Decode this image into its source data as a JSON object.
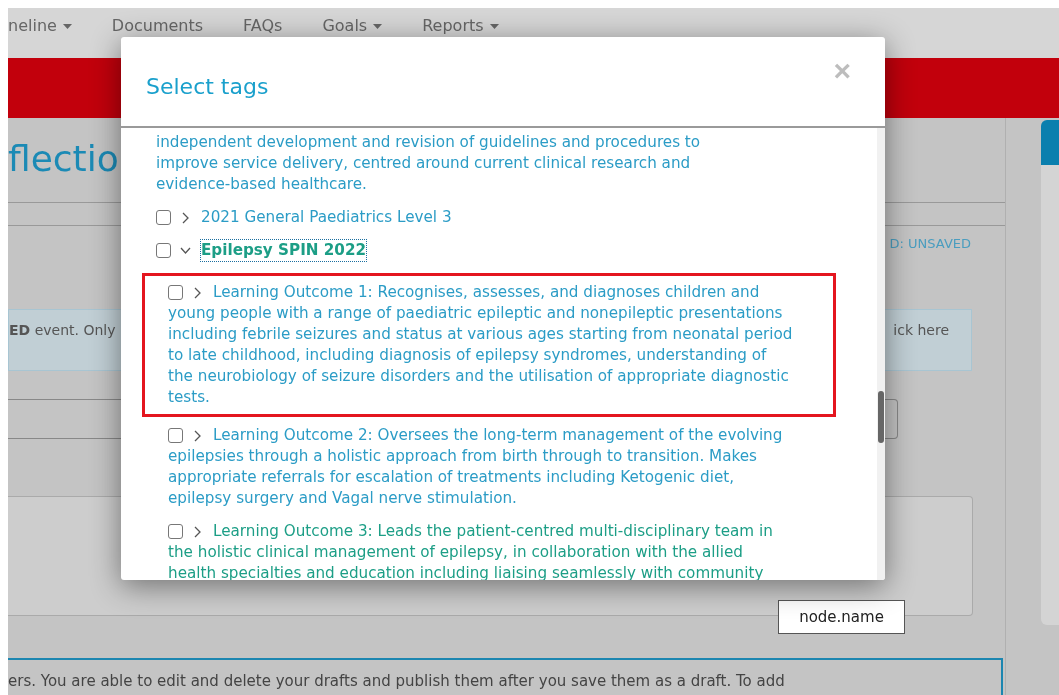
{
  "nav": [
    {
      "label": "neline",
      "dropdown": true
    },
    {
      "label": "Documents",
      "dropdown": false
    },
    {
      "label": "FAQs",
      "dropdown": false
    },
    {
      "label": "Goals",
      "dropdown": true
    },
    {
      "label": "Reports",
      "dropdown": true
    }
  ],
  "page": {
    "heading": "flectio",
    "status": "D: UNSAVED",
    "alert": {
      "left": "**ED** event. Only",
      "right": "ick here"
    },
    "tooltip": "node.name",
    "info": "ers. You are able to edit and delete your drafts and publish them after you save them as a draft. To add"
  },
  "modal": {
    "title": "Select tags",
    "close": "×",
    "tree": [
      {
        "kind": "text",
        "label": "independent development and revision of guidelines and procedures to improve service delivery, centred around current clinical research and evidence-based healthcare.",
        "color": "#2b9cc6"
      },
      {
        "kind": "node",
        "label": "2021 General Paediatrics Level 3",
        "checked": false,
        "expanded": false,
        "focused": false,
        "highlighted": false,
        "color": "#2b9cc6"
      },
      {
        "kind": "node",
        "label": "Epilepsy SPIN 2022",
        "checked": false,
        "expanded": true,
        "focused": true,
        "highlighted": false,
        "color": "#1c9e86",
        "children": [
          {
            "kind": "node",
            "label": "Learning Outcome 1: Recognises, assesses, and diagnoses children and young people with a range of paediatric epileptic and nonepileptic presentations including febrile seizures and status at various ages starting from neonatal period to late childhood, including diagnosis of epilepsy syndromes, understanding of the neurobiology of seizure disorders and the utilisation of appropriate diagnostic tests.",
            "checked": false,
            "expanded": false,
            "focused": false,
            "highlighted": true,
            "color": "#2b9cc6"
          },
          {
            "kind": "node",
            "label": "Learning Outcome 2: Oversees the long-term management of the evolving epilepsies through a holistic approach from birth through to transition. Makes appropriate referrals for escalation of treatments including Ketogenic diet, epilepsy surgery and Vagal nerve stimulation.",
            "checked": false,
            "expanded": false,
            "focused": false,
            "highlighted": false,
            "color": "#2b9cc6"
          },
          {
            "kind": "node",
            "label": "Learning Outcome 3: Leads the patient-centred multi-disciplinary team in the holistic clinical management of epilepsy, in collaboration with the allied health specialties and education including liaising seamlessly with community",
            "checked": false,
            "expanded": false,
            "focused": false,
            "highlighted": false,
            "color": "#1c9e86"
          }
        ]
      }
    ]
  }
}
